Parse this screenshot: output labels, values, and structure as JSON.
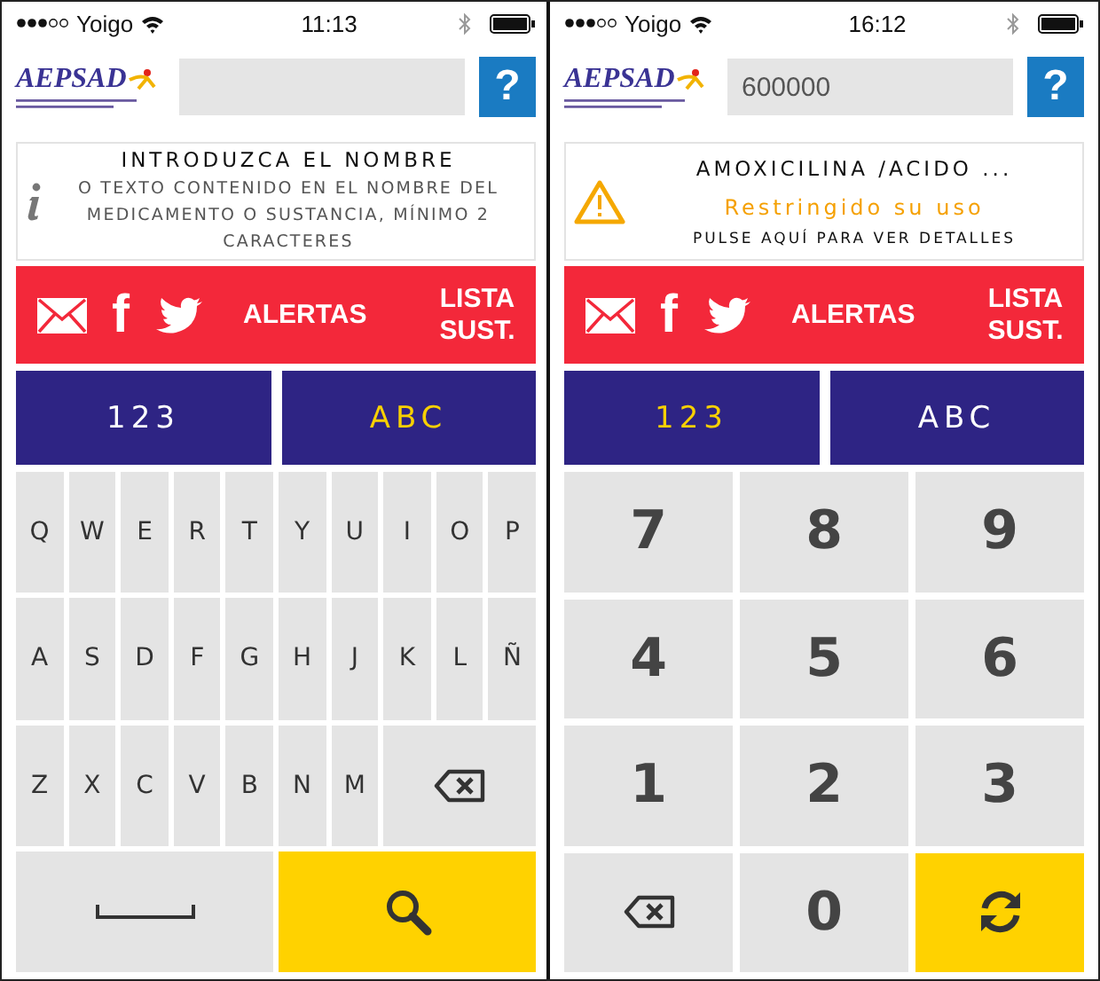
{
  "phones": [
    {
      "status": {
        "carrier": "Yoigo",
        "time": "11:13"
      },
      "header": {
        "logo": "AEPSAD",
        "help": "?"
      },
      "info": {
        "kind": "info",
        "title": "INTRODUZCA EL NOMBRE",
        "body": "O TEXTO CONTENIDO EN EL NOMBRE DEL MEDICAMENTO O SUSTANCIA, MÍNIMO 2 CARACTERES"
      },
      "bar": {
        "facebook": "f",
        "alerts": "ALERTAS",
        "list": "LISTA SUST."
      },
      "tabs": [
        {
          "label": "123",
          "selected": false
        },
        {
          "label": "ABC",
          "selected": true
        }
      ],
      "keyboard": {
        "kind": "letters",
        "rows": [
          [
            {
              "kind": "key",
              "label": "Q"
            },
            {
              "kind": "key",
              "label": "W"
            },
            {
              "kind": "key",
              "label": "E"
            },
            {
              "kind": "key",
              "label": "R"
            },
            {
              "kind": "key",
              "label": "T"
            },
            {
              "kind": "key",
              "label": "Y"
            },
            {
              "kind": "key",
              "label": "U"
            },
            {
              "kind": "key",
              "label": "I"
            },
            {
              "kind": "key",
              "label": "O"
            },
            {
              "kind": "key",
              "label": "P"
            }
          ],
          [
            {
              "kind": "key",
              "label": "A"
            },
            {
              "kind": "key",
              "label": "S"
            },
            {
              "kind": "key",
              "label": "D"
            },
            {
              "kind": "key",
              "label": "F"
            },
            {
              "kind": "key",
              "label": "G"
            },
            {
              "kind": "key",
              "label": "H"
            },
            {
              "kind": "key",
              "label": "J"
            },
            {
              "kind": "key",
              "label": "K"
            },
            {
              "kind": "key",
              "label": "L"
            },
            {
              "kind": "key",
              "label": "Ñ"
            }
          ],
          [
            {
              "kind": "key",
              "label": "Z"
            },
            {
              "kind": "key",
              "label": "X"
            },
            {
              "kind": "key",
              "label": "C"
            },
            {
              "kind": "key",
              "label": "V"
            },
            {
              "kind": "key",
              "label": "B"
            },
            {
              "kind": "key",
              "label": "N"
            },
            {
              "kind": "key",
              "label": "M"
            },
            {
              "kind": "backspace"
            }
          ],
          [
            {
              "kind": "space"
            },
            {
              "kind": "search"
            }
          ]
        ]
      }
    },
    {
      "status": {
        "carrier": "Yoigo",
        "time": "16:12"
      },
      "header": {
        "logo": "AEPSAD",
        "search_value": "600000",
        "help": "?"
      },
      "info": {
        "kind": "warning",
        "title": "AMOXICILINA /ACIDO ...",
        "status": "Restringido su uso",
        "hint": "PULSE AQUÍ PARA VER DETALLES"
      },
      "bar": {
        "facebook": "f",
        "alerts": "ALERTAS",
        "list": "LISTA SUST."
      },
      "tabs": [
        {
          "label": "123",
          "selected": true
        },
        {
          "label": "ABC",
          "selected": false
        }
      ],
      "keyboard": {
        "kind": "numbers",
        "rows": [
          [
            {
              "kind": "key",
              "label": "7"
            },
            {
              "kind": "key",
              "label": "8"
            },
            {
              "kind": "key",
              "label": "9"
            }
          ],
          [
            {
              "kind": "key",
              "label": "4"
            },
            {
              "kind": "key",
              "label": "5"
            },
            {
              "kind": "key",
              "label": "6"
            }
          ],
          [
            {
              "kind": "key",
              "label": "1"
            },
            {
              "kind": "key",
              "label": "2"
            },
            {
              "kind": "key",
              "label": "3"
            }
          ],
          [
            {
              "kind": "backspace"
            },
            {
              "kind": "key",
              "label": "0"
            },
            {
              "kind": "refresh"
            }
          ]
        ]
      }
    }
  ]
}
